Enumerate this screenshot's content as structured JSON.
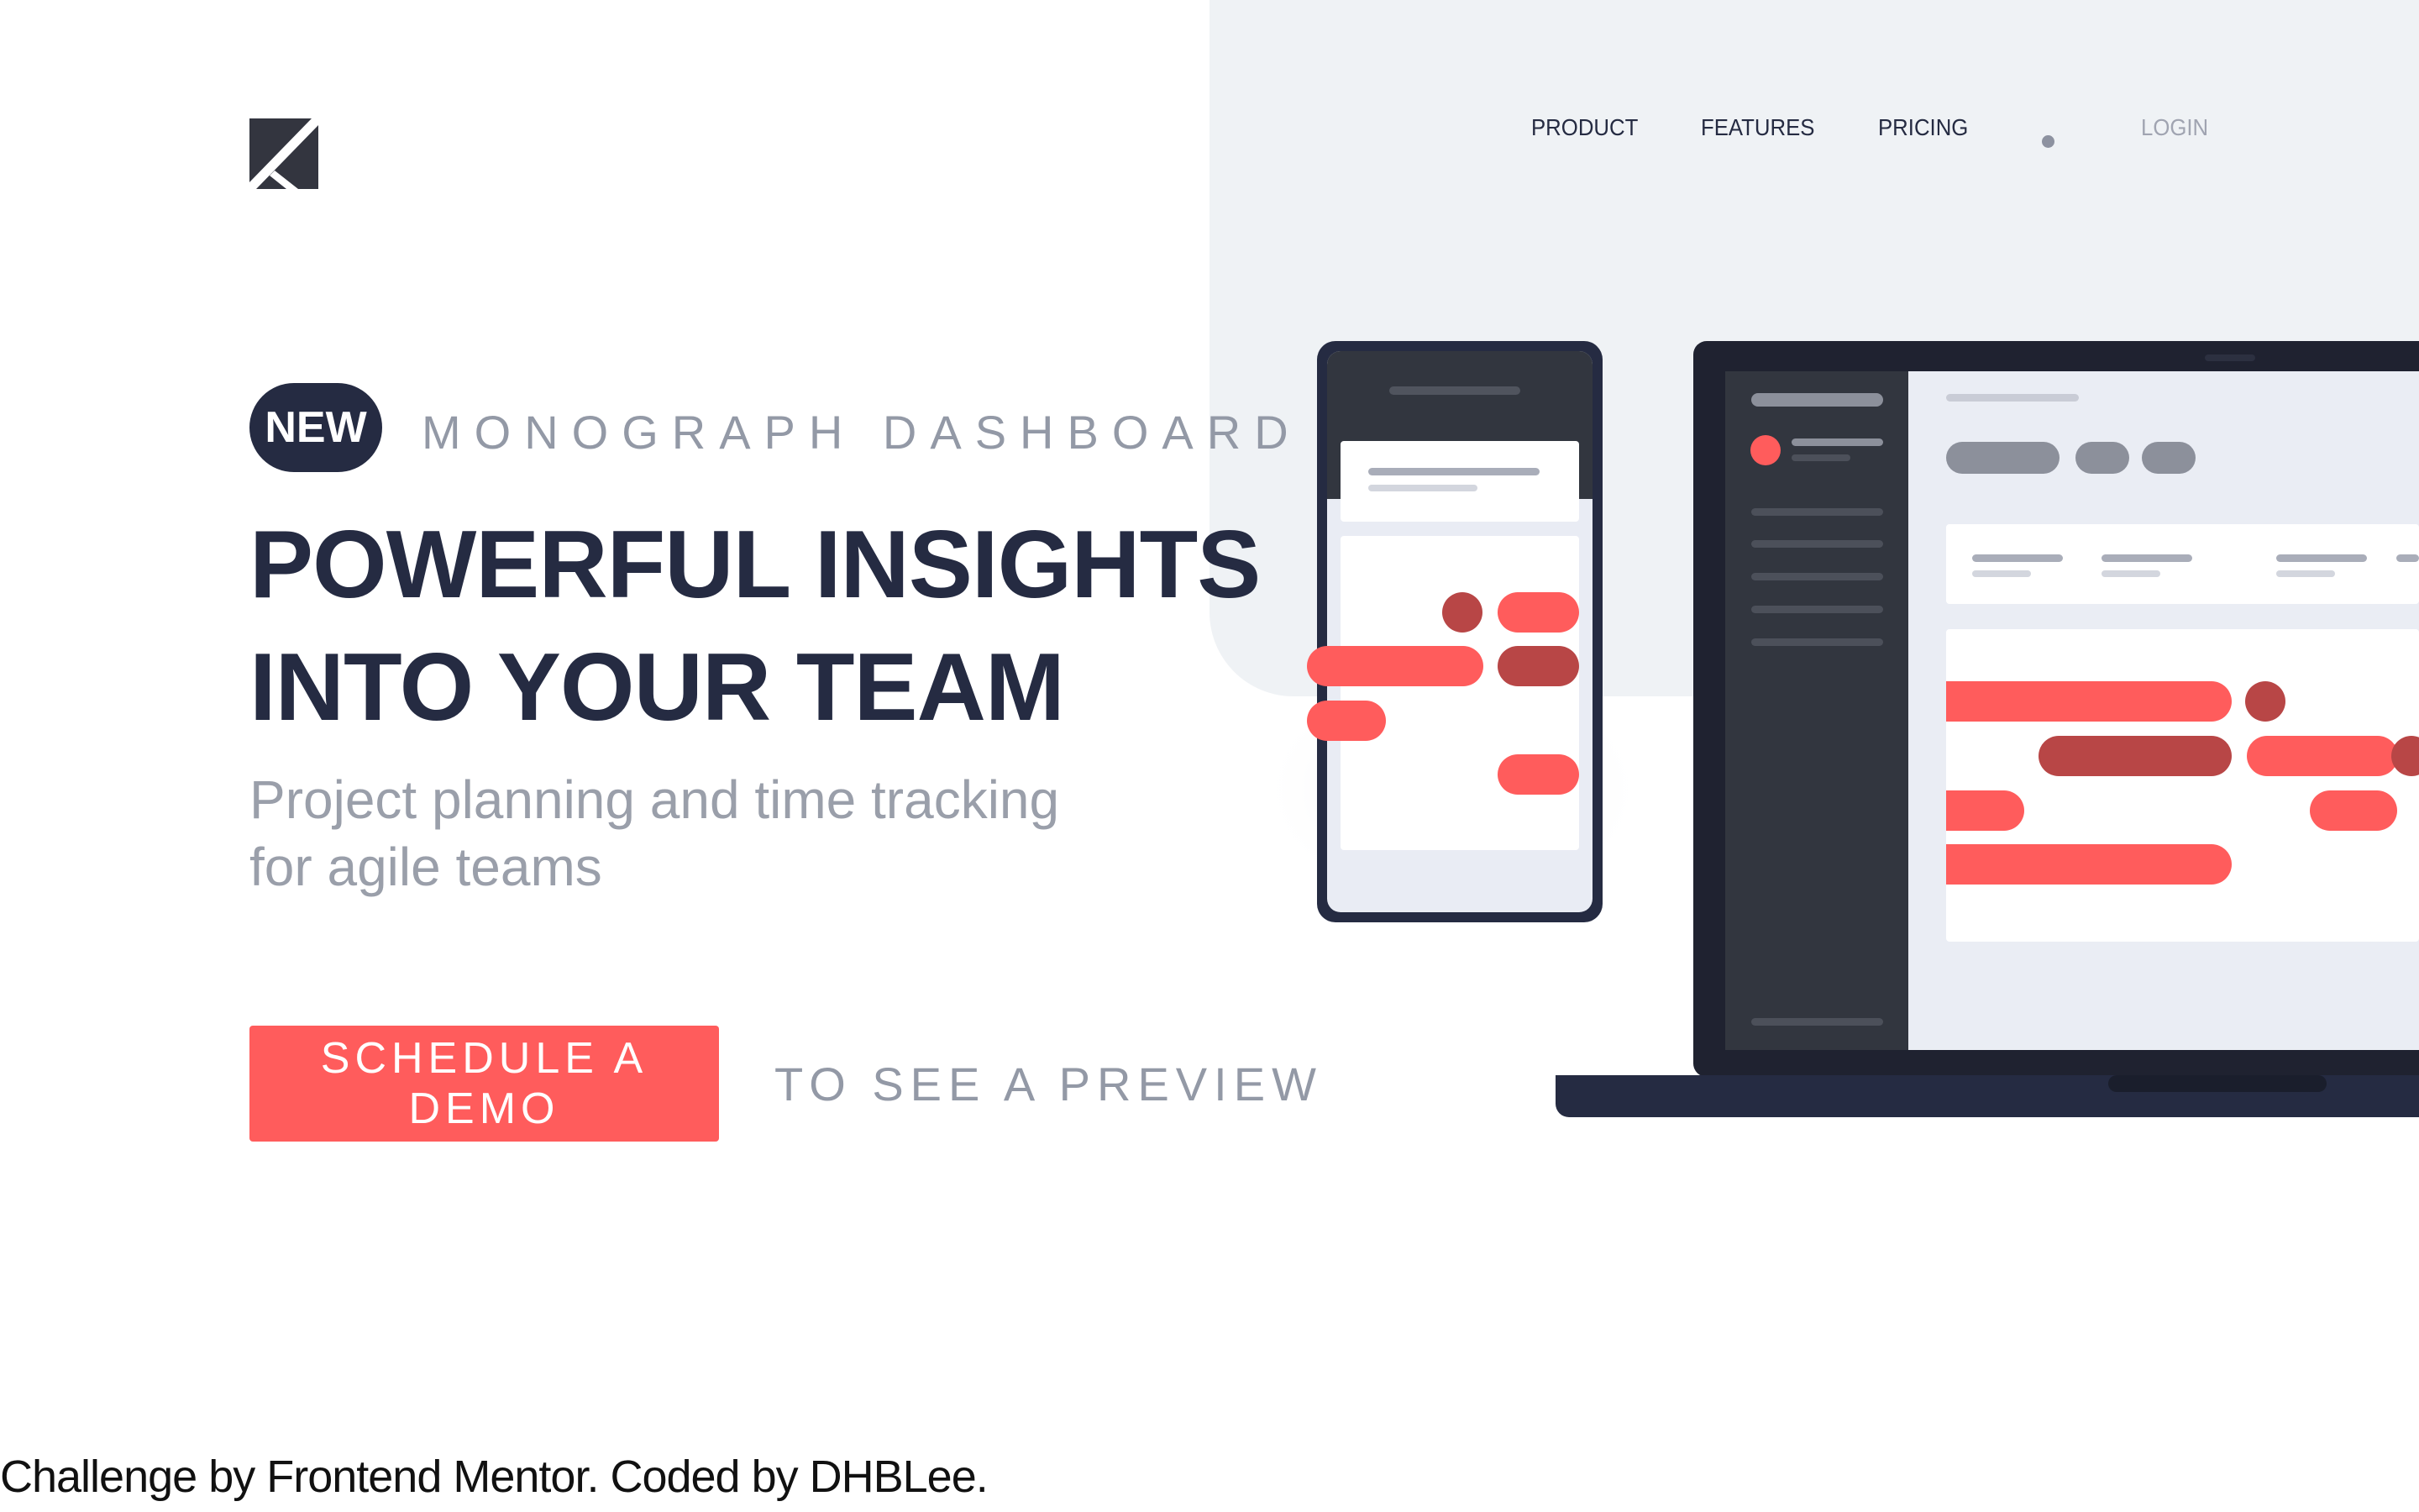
{
  "logo": {
    "icon": "monograph-logo-icon"
  },
  "nav": {
    "items": [
      {
        "label": "PRODUCT"
      },
      {
        "label": "FEATURES"
      },
      {
        "label": "PRICING"
      }
    ],
    "separator_icon": "dot-icon",
    "login_label": "LOGIN"
  },
  "hero": {
    "badge": "NEW",
    "eyebrow": "MONOGRAPH DASHBOARD",
    "headline_line1": "POWERFUL INSIGHTS",
    "headline_line2": "INTO YOUR TEAM",
    "subhead_line1": "Project planning and time tracking",
    "subhead_line2": "for agile teams",
    "cta_label": "SCHEDULE A DEMO",
    "preview_text": "TO SEE A PREVIEW"
  },
  "footer": {
    "attribution": "Challenge by Frontend Mentor. Coded by DHBLee."
  },
  "colors": {
    "accent": "#ff5c5c",
    "accent_dark": "#b84646",
    "navy": "#252b42",
    "panel_bg": "#eff2f5",
    "muted": "#9399a6"
  }
}
